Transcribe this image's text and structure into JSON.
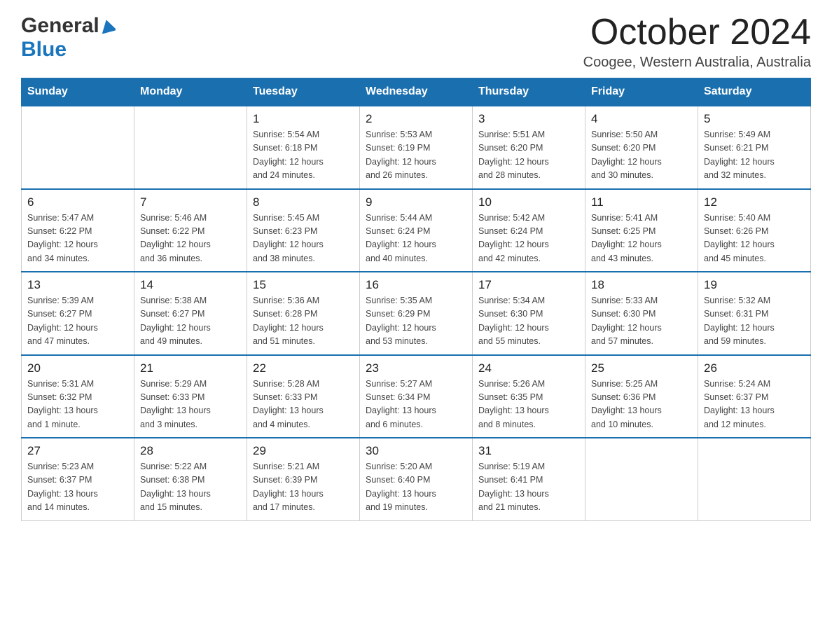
{
  "header": {
    "logo_general": "General",
    "logo_blue": "Blue",
    "title": "October 2024",
    "subtitle": "Coogee, Western Australia, Australia"
  },
  "weekdays": [
    "Sunday",
    "Monday",
    "Tuesday",
    "Wednesday",
    "Thursday",
    "Friday",
    "Saturday"
  ],
  "weeks": [
    [
      {
        "day": "",
        "info": ""
      },
      {
        "day": "",
        "info": ""
      },
      {
        "day": "1",
        "info": "Sunrise: 5:54 AM\nSunset: 6:18 PM\nDaylight: 12 hours\nand 24 minutes."
      },
      {
        "day": "2",
        "info": "Sunrise: 5:53 AM\nSunset: 6:19 PM\nDaylight: 12 hours\nand 26 minutes."
      },
      {
        "day": "3",
        "info": "Sunrise: 5:51 AM\nSunset: 6:20 PM\nDaylight: 12 hours\nand 28 minutes."
      },
      {
        "day": "4",
        "info": "Sunrise: 5:50 AM\nSunset: 6:20 PM\nDaylight: 12 hours\nand 30 minutes."
      },
      {
        "day": "5",
        "info": "Sunrise: 5:49 AM\nSunset: 6:21 PM\nDaylight: 12 hours\nand 32 minutes."
      }
    ],
    [
      {
        "day": "6",
        "info": "Sunrise: 5:47 AM\nSunset: 6:22 PM\nDaylight: 12 hours\nand 34 minutes."
      },
      {
        "day": "7",
        "info": "Sunrise: 5:46 AM\nSunset: 6:22 PM\nDaylight: 12 hours\nand 36 minutes."
      },
      {
        "day": "8",
        "info": "Sunrise: 5:45 AM\nSunset: 6:23 PM\nDaylight: 12 hours\nand 38 minutes."
      },
      {
        "day": "9",
        "info": "Sunrise: 5:44 AM\nSunset: 6:24 PM\nDaylight: 12 hours\nand 40 minutes."
      },
      {
        "day": "10",
        "info": "Sunrise: 5:42 AM\nSunset: 6:24 PM\nDaylight: 12 hours\nand 42 minutes."
      },
      {
        "day": "11",
        "info": "Sunrise: 5:41 AM\nSunset: 6:25 PM\nDaylight: 12 hours\nand 43 minutes."
      },
      {
        "day": "12",
        "info": "Sunrise: 5:40 AM\nSunset: 6:26 PM\nDaylight: 12 hours\nand 45 minutes."
      }
    ],
    [
      {
        "day": "13",
        "info": "Sunrise: 5:39 AM\nSunset: 6:27 PM\nDaylight: 12 hours\nand 47 minutes."
      },
      {
        "day": "14",
        "info": "Sunrise: 5:38 AM\nSunset: 6:27 PM\nDaylight: 12 hours\nand 49 minutes."
      },
      {
        "day": "15",
        "info": "Sunrise: 5:36 AM\nSunset: 6:28 PM\nDaylight: 12 hours\nand 51 minutes."
      },
      {
        "day": "16",
        "info": "Sunrise: 5:35 AM\nSunset: 6:29 PM\nDaylight: 12 hours\nand 53 minutes."
      },
      {
        "day": "17",
        "info": "Sunrise: 5:34 AM\nSunset: 6:30 PM\nDaylight: 12 hours\nand 55 minutes."
      },
      {
        "day": "18",
        "info": "Sunrise: 5:33 AM\nSunset: 6:30 PM\nDaylight: 12 hours\nand 57 minutes."
      },
      {
        "day": "19",
        "info": "Sunrise: 5:32 AM\nSunset: 6:31 PM\nDaylight: 12 hours\nand 59 minutes."
      }
    ],
    [
      {
        "day": "20",
        "info": "Sunrise: 5:31 AM\nSunset: 6:32 PM\nDaylight: 13 hours\nand 1 minute."
      },
      {
        "day": "21",
        "info": "Sunrise: 5:29 AM\nSunset: 6:33 PM\nDaylight: 13 hours\nand 3 minutes."
      },
      {
        "day": "22",
        "info": "Sunrise: 5:28 AM\nSunset: 6:33 PM\nDaylight: 13 hours\nand 4 minutes."
      },
      {
        "day": "23",
        "info": "Sunrise: 5:27 AM\nSunset: 6:34 PM\nDaylight: 13 hours\nand 6 minutes."
      },
      {
        "day": "24",
        "info": "Sunrise: 5:26 AM\nSunset: 6:35 PM\nDaylight: 13 hours\nand 8 minutes."
      },
      {
        "day": "25",
        "info": "Sunrise: 5:25 AM\nSunset: 6:36 PM\nDaylight: 13 hours\nand 10 minutes."
      },
      {
        "day": "26",
        "info": "Sunrise: 5:24 AM\nSunset: 6:37 PM\nDaylight: 13 hours\nand 12 minutes."
      }
    ],
    [
      {
        "day": "27",
        "info": "Sunrise: 5:23 AM\nSunset: 6:37 PM\nDaylight: 13 hours\nand 14 minutes."
      },
      {
        "day": "28",
        "info": "Sunrise: 5:22 AM\nSunset: 6:38 PM\nDaylight: 13 hours\nand 15 minutes."
      },
      {
        "day": "29",
        "info": "Sunrise: 5:21 AM\nSunset: 6:39 PM\nDaylight: 13 hours\nand 17 minutes."
      },
      {
        "day": "30",
        "info": "Sunrise: 5:20 AM\nSunset: 6:40 PM\nDaylight: 13 hours\nand 19 minutes."
      },
      {
        "day": "31",
        "info": "Sunrise: 5:19 AM\nSunset: 6:41 PM\nDaylight: 13 hours\nand 21 minutes."
      },
      {
        "day": "",
        "info": ""
      },
      {
        "day": "",
        "info": ""
      }
    ]
  ]
}
